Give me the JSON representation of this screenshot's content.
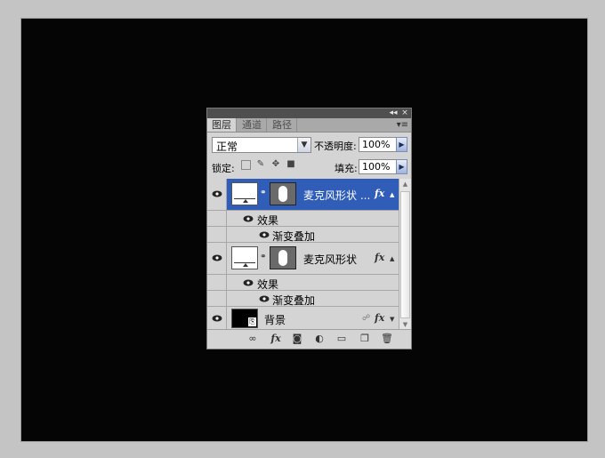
{
  "panel": {
    "tabs": [
      {
        "label": "图层",
        "active": true
      },
      {
        "label": "通道",
        "active": false
      },
      {
        "label": "路径",
        "active": false
      }
    ],
    "titlebar": {
      "collapse_glyph": "◂◂",
      "close_glyph": "×"
    },
    "menu_glyph": "▾≡",
    "blend_mode": "正常",
    "opacity_label": "不透明度:",
    "opacity_value": "100%",
    "lock_label": "锁定:",
    "fill_label": "填充:",
    "fill_value": "100%"
  },
  "layers": [
    {
      "name": "麦克风形状 ...",
      "selected": true,
      "effects_label": "效果",
      "effect_item": "渐变叠加",
      "fx": "fx"
    },
    {
      "name": "麦克风形状",
      "selected": false,
      "effects_label": "效果",
      "effect_item": "渐变叠加",
      "fx": "fx"
    },
    {
      "name": "背景",
      "selected": false,
      "fx": "fx"
    }
  ],
  "colors": {
    "selection": "#2f5db7",
    "panel_bg": "#d4d4d4",
    "canvas_bg": "#050505"
  },
  "icons": [
    "link-layers-icon",
    "add-style-icon",
    "add-mask-icon",
    "adjustment-layer-icon",
    "group-icon",
    "new-layer-icon",
    "delete-icon"
  ]
}
